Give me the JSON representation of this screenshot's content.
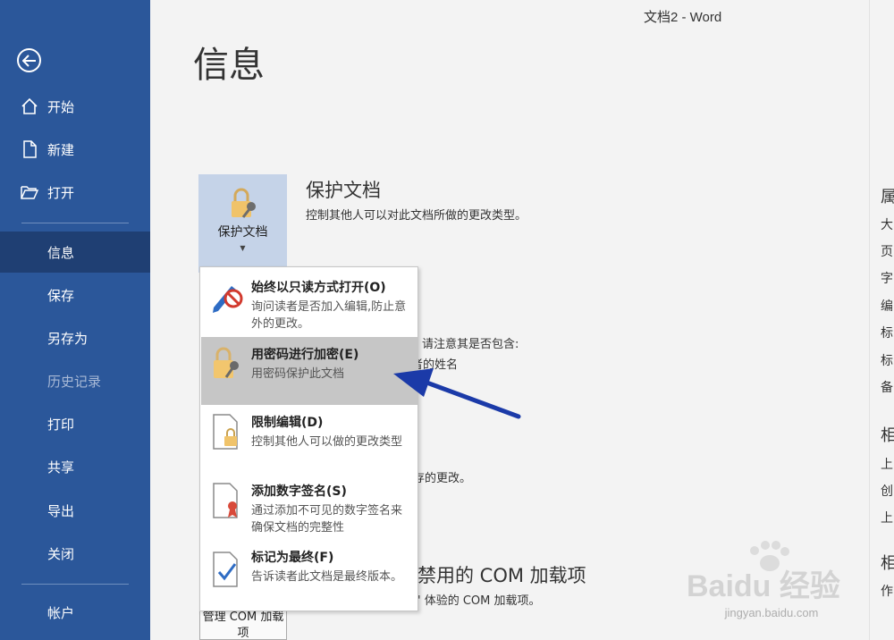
{
  "window": {
    "title": "文档2  -  Word"
  },
  "sidebar": {
    "items": [
      {
        "label": "开始",
        "icon": "home-icon"
      },
      {
        "label": "新建",
        "icon": "new-document-icon"
      },
      {
        "label": "打开",
        "icon": "open-folder-icon"
      },
      {
        "label": "信息",
        "state": "active"
      },
      {
        "label": "保存"
      },
      {
        "label": "另存为"
      },
      {
        "label": "历史记录",
        "state": "disabled"
      },
      {
        "label": "打印"
      },
      {
        "label": "共享"
      },
      {
        "label": "导出"
      },
      {
        "label": "关闭"
      },
      {
        "label": "帐户"
      }
    ]
  },
  "page": {
    "title": "信息"
  },
  "protect": {
    "button_label": "保护文档",
    "title": "保护文档",
    "description": "控制其他人可以对此文档所做的更改类型。"
  },
  "background": {
    "inspect_line1": "请注意其是否包含:",
    "inspect_line2": "者的姓名",
    "versions_line": "存的更改。",
    "com_title": "禁用的 COM 加载项",
    "com_desc": "' 体验的 COM 加载项。",
    "com_button": "管理 COM 加载项",
    "right_col": [
      "属",
      "大",
      "页",
      "字",
      "编",
      "标",
      "标",
      "备",
      "相",
      "上",
      "创",
      "上",
      "相",
      "作"
    ]
  },
  "dropdown": {
    "items": [
      {
        "title": "始终以只读方式打开(O)",
        "desc": "询问读者是否加入编辑,防止意外的更改。"
      },
      {
        "title": "用密码进行加密(E)",
        "desc": "用密码保护此文档"
      },
      {
        "title": "限制编辑(D)",
        "desc": "控制其他人可以做的更改类型"
      },
      {
        "title": "添加数字签名(S)",
        "desc": "通过添加不可见的数字签名来确保文档的完整性"
      },
      {
        "title": "标记为最终(F)",
        "desc": "告诉读者此文档是最终版本。"
      }
    ]
  },
  "watermark": {
    "brand": "Baidu 经验",
    "url": "jingyan.baidu.com"
  },
  "colors": {
    "sidebar": "#2b579a",
    "sidebar_active": "#1f3f73",
    "highlight": "#c6c6c6",
    "annotation_arrow": "#1b3aa8"
  }
}
